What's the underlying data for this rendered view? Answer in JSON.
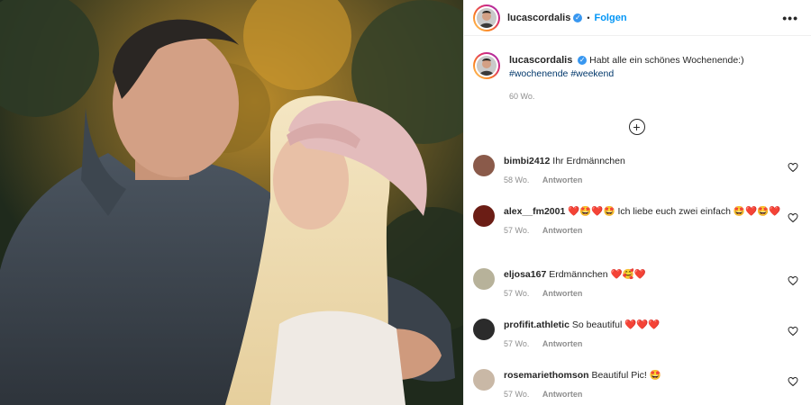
{
  "post": {
    "username": "lucascordalis",
    "follow_label": "Folgen",
    "separator": "•",
    "more_icon": "more-horizontal-icon"
  },
  "caption": {
    "username": "lucascordalis",
    "text": "Habt alle ein schönes Wochenende:)",
    "hashtags": [
      "#wochenende",
      "#weekend"
    ],
    "time": "60 Wo."
  },
  "load_more_icon": "plus-circle-icon",
  "comments": [
    {
      "user": "bimbi2412",
      "text": "Ihr Erdmännchen",
      "emojis_after": "",
      "time": "58 Wo.",
      "reply": "Antworten",
      "avatar_color": "#8a5a4a"
    },
    {
      "user": "alex__fm2001",
      "text": "Ich liebe euch zwei einfach",
      "emojis_before": "❤️🤩❤️🤩",
      "emojis_after": "🤩❤️🤩❤️",
      "time": "57 Wo.",
      "reply": "Antworten",
      "avatar_color": "#6b1d15"
    },
    {
      "user": "eljosa167",
      "text": "Erdmännchen",
      "emojis_after": "❤️🥰❤️",
      "time": "57 Wo.",
      "reply": "Antworten",
      "avatar_color": "#b7b29a"
    },
    {
      "user": "profifit.athletic",
      "text": "So beautiful",
      "emojis_after": "❤️❤️❤️",
      "time": "57 Wo.",
      "reply": "Antworten",
      "avatar_color": "#2b2b2b"
    },
    {
      "user": "rosemariethomson",
      "text": "Beautiful Pic!",
      "emojis_after": "🤩",
      "time": "57 Wo.",
      "reply": "Antworten",
      "avatar_color": "#c9b8a6"
    }
  ],
  "colors": {
    "accent": "#0095f6",
    "hashtag": "#00376b",
    "muted": "#8e8e8e",
    "heart_emoji": "#e0245e"
  }
}
